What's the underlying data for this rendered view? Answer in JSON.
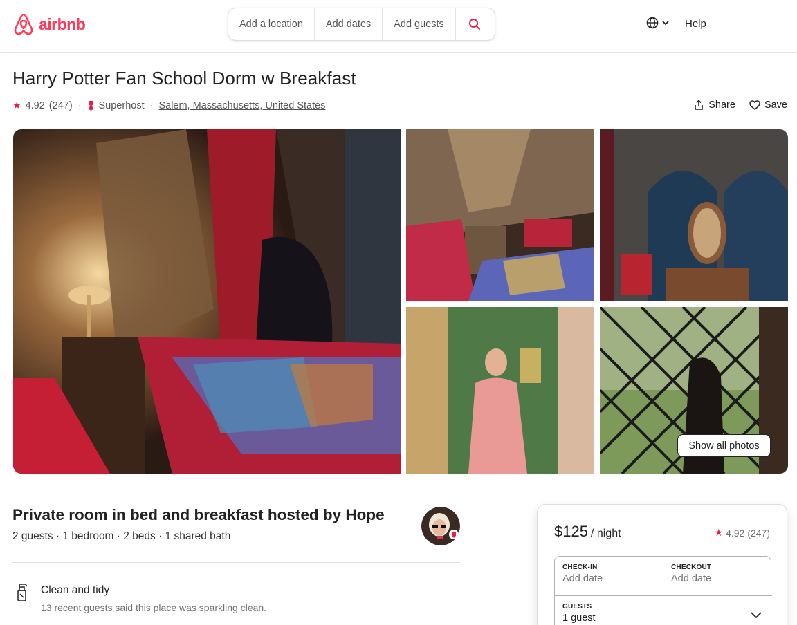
{
  "header": {
    "logo_text": "airbnb",
    "search": {
      "location": "Add a location",
      "dates": "Add dates",
      "guests": "Add guests"
    },
    "help": "Help"
  },
  "listing": {
    "title": "Harry Potter Fan School Dorm w Breakfast",
    "rating": "4.92",
    "reviews": "(247)",
    "superhost": "Superhost",
    "location": "Salem, Massachusetts, United States",
    "share": "Share",
    "save": "Save",
    "show_all_photos": "Show all photos"
  },
  "details": {
    "room_title": "Private room in bed and breakfast hosted by Hope",
    "room_sub": "2 guests · 1 bedroom · 2 beds · 1 shared bath",
    "highlight_title": "Clean and tidy",
    "highlight_sub": "13 recent guests said this place was sparkling clean."
  },
  "booking": {
    "price": "$125",
    "per_night": "/ night",
    "rating": "4.92",
    "reviews": "(247)",
    "checkin_label": "CHECK-IN",
    "checkin_value": "Add date",
    "checkout_label": "CHECKOUT",
    "checkout_value": "Add date",
    "guests_label": "GUESTS",
    "guests_value": "1 guest"
  },
  "colors": {
    "brand": "#ff385c",
    "star": "#e61e4d",
    "text": "#222222",
    "muted": "#717171"
  },
  "icons": [
    "airbnb-logo-icon",
    "search-icon",
    "globe-icon",
    "chevron-down-icon",
    "star-icon",
    "superhost-icon",
    "share-icon",
    "heart-icon",
    "spray-bottle-icon"
  ]
}
